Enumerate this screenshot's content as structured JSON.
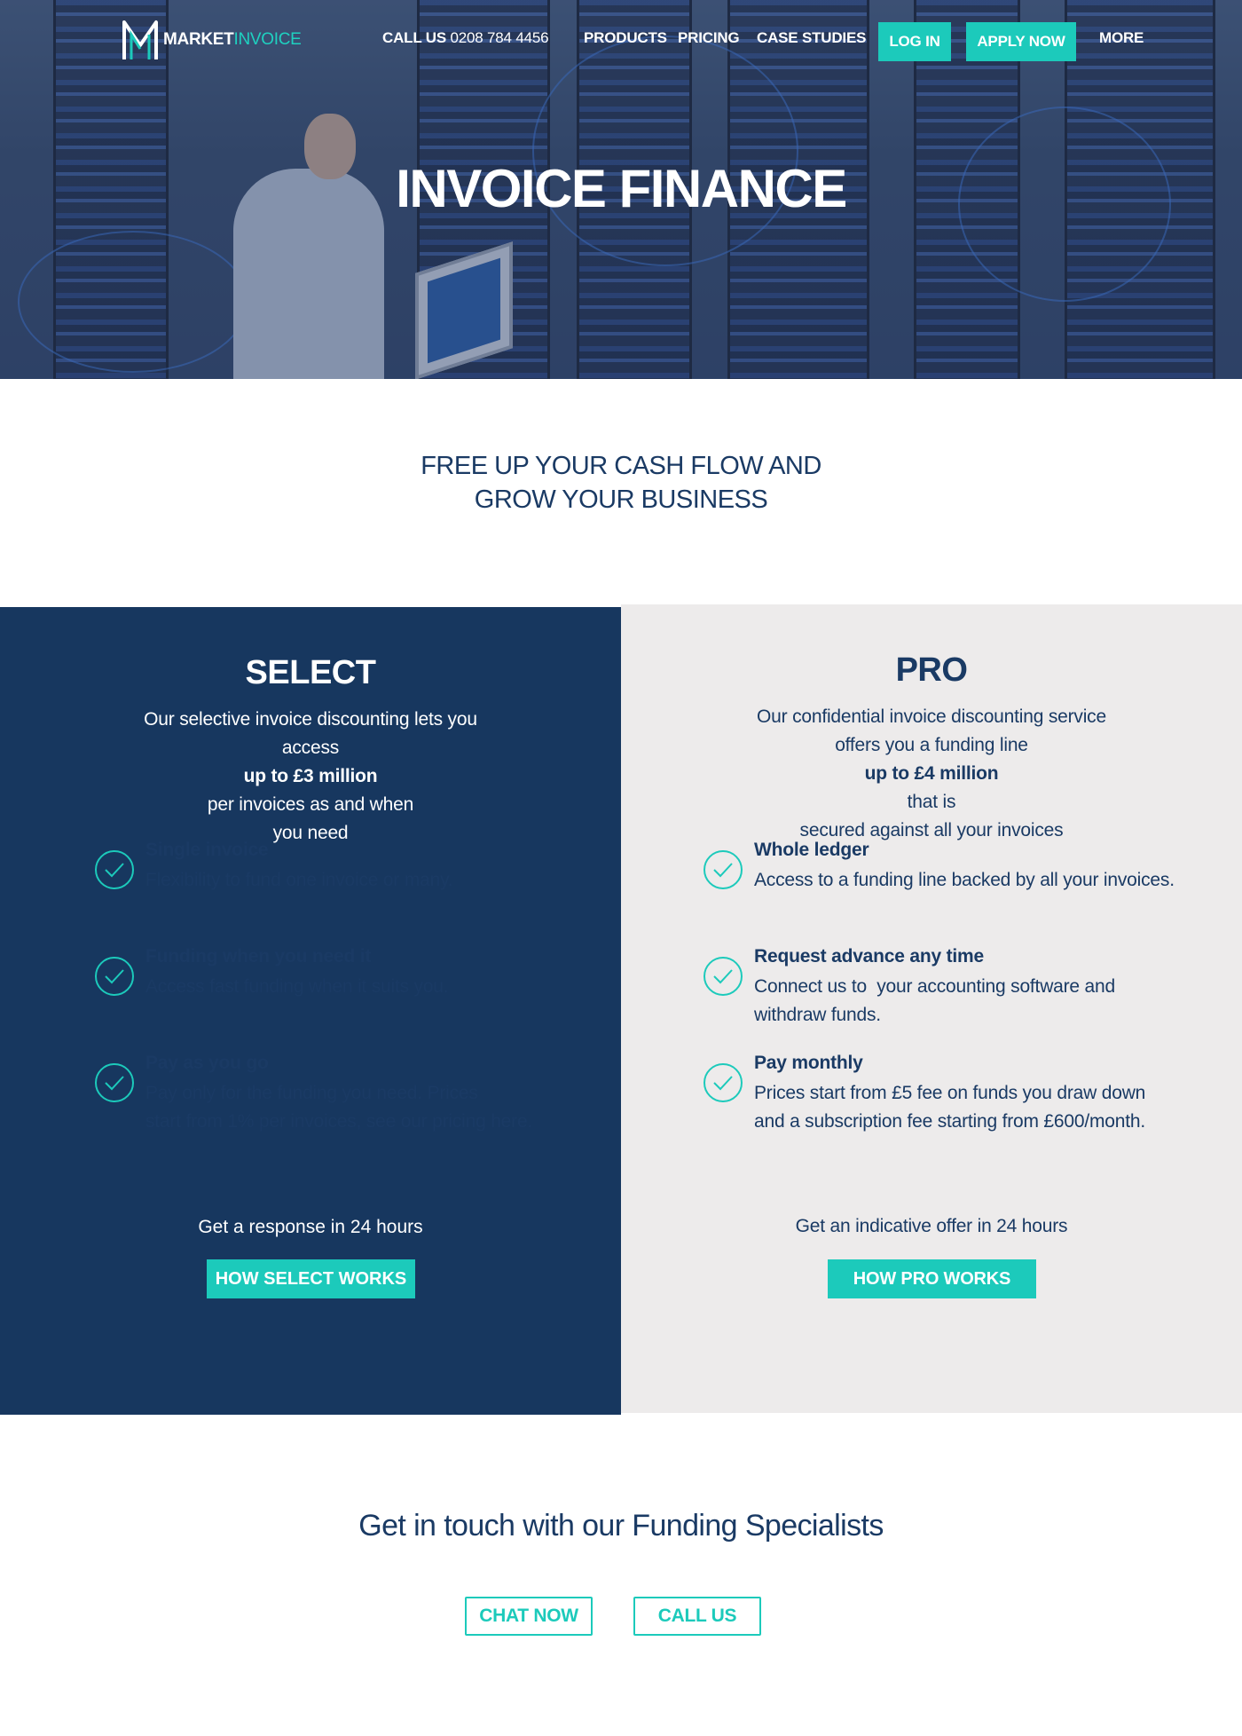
{
  "brand": {
    "name_part1": "MARKET",
    "name_part2": "INVOICE",
    "accent_color": "#1ccabb",
    "navy_color": "#17375f"
  },
  "nav": {
    "call_label": "CALL US",
    "call_number": "0208 784 4456",
    "products": "PRODUCTS",
    "pricing": "PRICING",
    "case_studies": "CASE STUDIES",
    "login": "LOG IN",
    "apply": "APPLY NOW",
    "more": "MORE"
  },
  "hero": {
    "title": "INVOICE FINANCE"
  },
  "tagline": {
    "line1": "FREE UP YOUR CASH FLOW AND",
    "line2": "GROW YOUR BUSINESS"
  },
  "select": {
    "title": "SELECT",
    "intro_line1": "Our selective invoice discounting lets you",
    "intro_line2_pre": "access ",
    "intro_line2_bold": "up to £3 million",
    "intro_line2_post": " per invoices as and when",
    "intro_line3": "you need",
    "features": [
      {
        "icon": "check-circle-icon",
        "title": "Single invoice",
        "desc": [
          "Flexibility to fund one invoice or many."
        ]
      },
      {
        "icon": "check-circle-icon",
        "title": "Funding when you need it",
        "desc": [
          "Access fast funding when it suits you."
        ]
      },
      {
        "icon": "check-circle-icon",
        "title": "Pay as you go",
        "desc": [
          "Pay only for the funding you need. Prices",
          "start from 1% per invoices, see our pricing here."
        ]
      }
    ],
    "response": "Get a response in 24 hours",
    "cta": "HOW SELECT WORKS"
  },
  "pro": {
    "title": "PRO",
    "intro_line1": "Our confidential invoice discounting service",
    "intro_line2_pre": "offers you a funding line ",
    "intro_line2_bold": "up to £4 million",
    "intro_line2_post": " that is",
    "intro_line3": "secured against all your invoices",
    "features": [
      {
        "icon": "check-circle-icon",
        "title": "Whole ledger",
        "desc": [
          "Access to a funding line backed by all your invoices."
        ]
      },
      {
        "icon": "check-circle-icon",
        "title": "Request advance any time",
        "desc": [
          "Connect us to  your accounting software and",
          "withdraw funds."
        ]
      },
      {
        "icon": "check-circle-icon",
        "title": "Pay monthly",
        "desc": [
          "Prices start from £5 fee on funds you draw down",
          "and a subscription fee starting from £600/month."
        ]
      }
    ],
    "response": "Get an indicative offer in 24 hours",
    "cta": "HOW PRO WORKS"
  },
  "contact": {
    "title": "Get in touch with our Funding Specialists",
    "chat": "CHAT NOW",
    "call": "CALL US"
  }
}
